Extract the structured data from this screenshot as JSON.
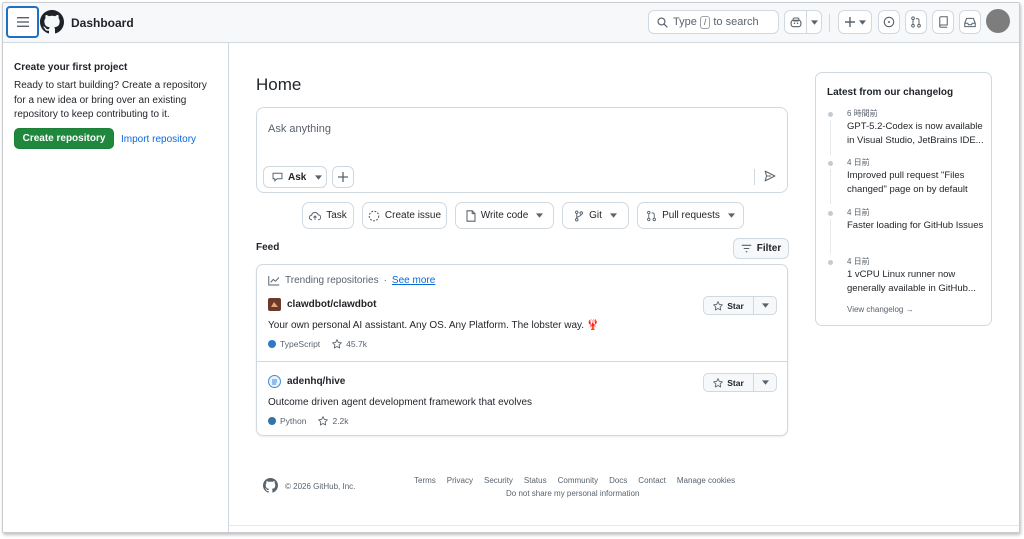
{
  "header": {
    "title": "Dashboard",
    "search": {
      "prefix": "Type",
      "key": "/",
      "suffix": "to search"
    }
  },
  "sidebar": {
    "title": "Create your first project",
    "description": "Ready to start building? Create a repository for a new idea or bring over an existing repository to keep contributing to it.",
    "create_label": "Create repository",
    "import_label": "Import repository"
  },
  "main": {
    "title": "Home",
    "ask_placeholder": "Ask anything",
    "ask_label": "Ask",
    "actions": [
      {
        "label": "Task"
      },
      {
        "label": "Create issue"
      },
      {
        "label": "Write code"
      },
      {
        "label": "Git"
      },
      {
        "label": "Pull requests"
      }
    ],
    "feed_label": "Feed",
    "filter_label": "Filter",
    "trending": {
      "label": "Trending repositories",
      "separator": "·",
      "see_more": "See more",
      "repos": [
        {
          "name": "clawdbot/clawdbot",
          "description": "Your own personal AI assistant. Any OS. Any Platform. The lobster way. 🦞",
          "language": "TypeScript",
          "language_color": "#3178c6",
          "stars": "45.7k",
          "star_label": "Star"
        },
        {
          "name": "adenhq/hive",
          "description": "Outcome driven agent development framework that evolves",
          "language": "Python",
          "language_color": "#3572a5",
          "stars": "2.2k",
          "star_label": "Star"
        }
      ]
    }
  },
  "footer": {
    "copyright": "© 2026 GitHub, Inc.",
    "links": [
      "Terms",
      "Privacy",
      "Security",
      "Status",
      "Community",
      "Docs",
      "Contact",
      "Manage cookies"
    ],
    "notice": "Do not share my personal information"
  },
  "changelog": {
    "title": "Latest from our changelog",
    "items": [
      {
        "time": "6 時間前",
        "text": "GPT-5.2-Codex is now available in Visual Studio, JetBrains IDE..."
      },
      {
        "time": "4 日前",
        "text": "Improved pull request \"Files changed\" page on by default"
      },
      {
        "time": "4 日前",
        "text": "Faster loading for GitHub Issues"
      },
      {
        "time": "4 日前",
        "text": "1 vCPU Linux runner now generally available in GitHub..."
      }
    ],
    "view_label": "View changelog →"
  },
  "colors": {
    "primary_green": "#1f883d",
    "link_blue": "#0969da",
    "border": "#d1d9e0",
    "header_bg": "#f6f8fa"
  }
}
